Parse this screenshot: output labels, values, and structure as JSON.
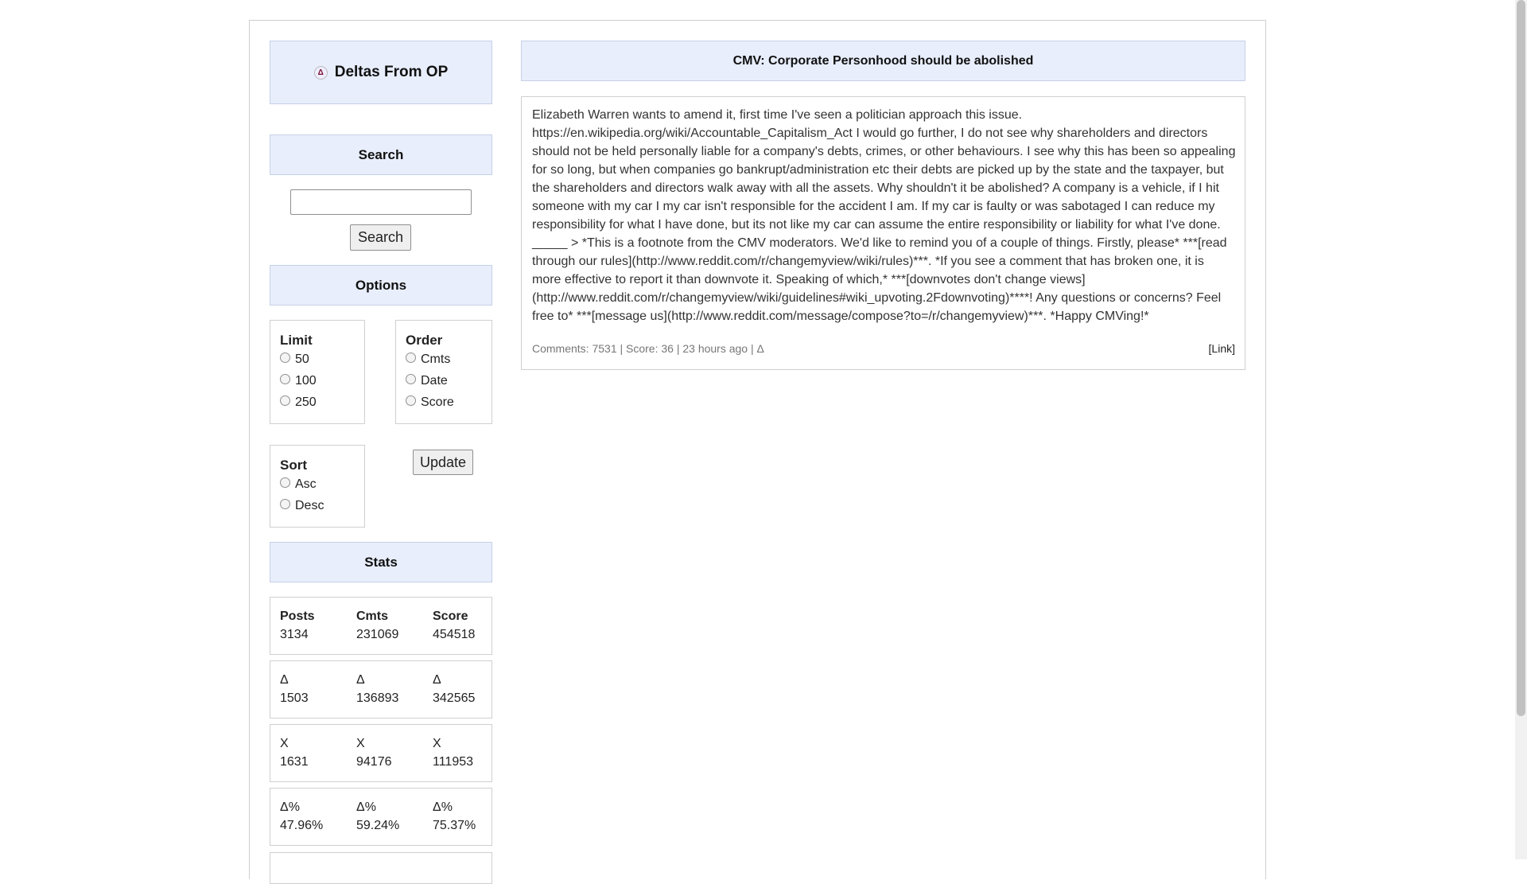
{
  "sidebar": {
    "deltas_title": "Deltas From OP",
    "delta_glyph": "Δ",
    "search_heading": "Search",
    "search_input_value": "",
    "search_button": "Search",
    "options_heading": "Options",
    "limit": {
      "title": "Limit",
      "options": [
        "50",
        "100",
        "250"
      ]
    },
    "order": {
      "title": "Order",
      "options": [
        "Cmts",
        "Date",
        "Score"
      ]
    },
    "sort": {
      "title": "Sort",
      "options": [
        "Asc",
        "Desc"
      ]
    },
    "update_button": "Update",
    "stats_heading": "Stats",
    "stats": [
      [
        {
          "label": "Posts",
          "value": "3134"
        },
        {
          "label": "Cmts",
          "value": "231069"
        },
        {
          "label": "Score",
          "value": "454518"
        }
      ],
      [
        {
          "label": "Δ",
          "value": "1503"
        },
        {
          "label": "Δ",
          "value": "136893"
        },
        {
          "label": "Δ",
          "value": "342565"
        }
      ],
      [
        {
          "label": "X",
          "value": "1631"
        },
        {
          "label": "X",
          "value": "94176"
        },
        {
          "label": "X",
          "value": "111953"
        }
      ],
      [
        {
          "label": "Δ%",
          "value": "47.96%"
        },
        {
          "label": "Δ%",
          "value": "59.24%"
        },
        {
          "label": "Δ%",
          "value": "75.37%"
        }
      ]
    ]
  },
  "post": {
    "title": "CMV: Corporate Personhood should be abolished",
    "body": "Elizabeth Warren wants to amend it, first time I've seen a politician approach this issue. https://en.wikipedia.org/wiki/Accountable_Capitalism_Act I would go further, I do not see why shareholders and directors should not be held personally liable for a company's debts, crimes, or other behaviours. I see why this has been so appealing for so long, but when companies go bankrupt/administration etc their debts are picked up by the state and the taxpayer, but the shareholders and directors walk away with all the assets. Why shouldn't it be abolished? A company is a vehicle, if I hit someone with my car I my car isn't responsible for the accident I am. If my car is faulty or was sabotaged I can reduce my responsibility for what I have done, but its not like my car can assume the entire responsibility or liability for what I've done. _____ > *This is a footnote from the CMV moderators. We'd like to remind you of a couple of things. Firstly, please* ***[read through our rules](http://www.reddit.com/r/changemyview/wiki/rules)***. *If you see a comment that has broken one, it is more effective to report it than downvote it. Speaking of which,* ***[downvotes don't change views](http://www.reddit.com/r/changemyview/wiki/guidelines#wiki_upvoting.2Fdownvoting)****! Any questions or concerns? Feel free to* ***[message us](http://www.reddit.com/message/compose?to=/r/changemyview)***. *Happy CMVing!*",
    "meta": "Comments: 7531 | Score: 36 | 23 hours ago | Δ",
    "link_label": "[Link]"
  }
}
